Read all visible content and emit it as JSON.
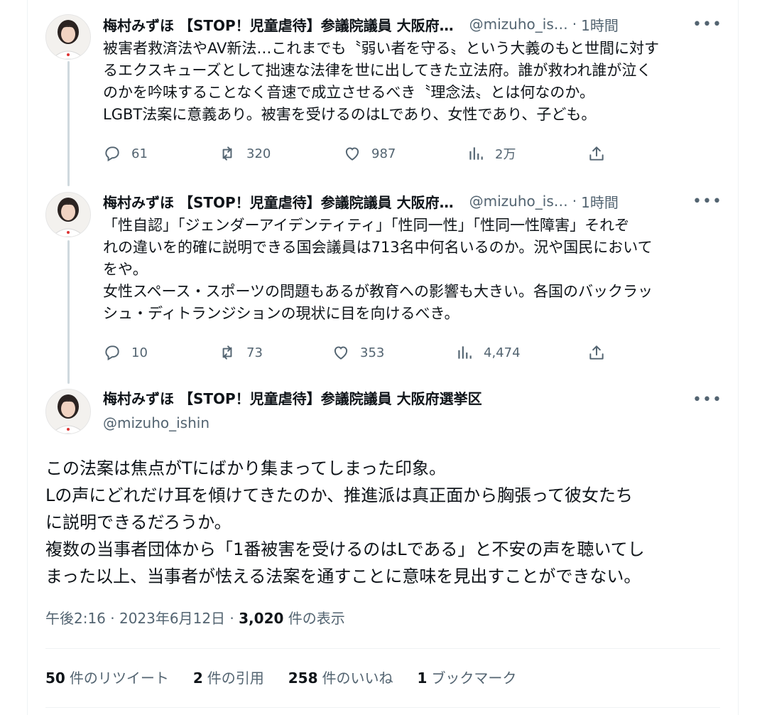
{
  "tweets": [
    {
      "name": "梅村みずほ 【STOP！児童虐待】参議院議員 大阪府…",
      "handle": "@mizuho_is…",
      "time": "1時間",
      "more": "•••",
      "text": "被害者救済法やAV新法…これまでも〝弱い者を守る〟という大義のもと世間に対す\nるエクスキューズとして拙速な法律を世に出してきた立法府。誰が救われ誰が泣く\nのかを吟味することなく音速で成立させるべき〝理念法〟とは何なのか。\nLGBT法案に意義あり。被害を受けるのはLであり、女性であり、子ども。",
      "replies": "61",
      "retweets": "320",
      "likes": "987",
      "views": "2万"
    },
    {
      "name": "梅村みずほ 【STOP！児童虐待】参議院議員 大阪府…",
      "handle": "@mizuho_is…",
      "time": "1時間",
      "more": "•••",
      "text": "「性自認」「ジェンダーアイデンティティ」「性同一性」「性同一性障害」それぞ\nれの違いを的確に説明できる国会議員は713名中何名いるのか。況や国民において\nをや。\n女性スペース・スポーツの問題もあるが教育への影響も大きい。各国のバックラッ\nシュ・ディトランジションの現状に目を向けるべき。",
      "replies": "10",
      "retweets": "73",
      "likes": "353",
      "views": "4,474"
    }
  ],
  "main_tweet": {
    "name": "梅村みずほ 【STOP！児童虐待】参議院議員 大阪府選挙区",
    "handle": "@mizuho_ishin",
    "more": "•••",
    "text": "この法案は焦点がTにばかり集まってしまった印象。\nLの声にどれだけ耳を傾けてきたのか、推進派は真正面から胸張って彼女たち\nに説明できるだろうか。\n複数の当事者団体から「1番被害を受けるのはLである」と不安の声を聴いてし\nまった以上、当事者が怯える法案を通すことに意味を見出すことができない。",
    "timestamp": "午後2:16 · 2023年6月12日 · ",
    "views_count": "3,020",
    "views_label": " 件の表示",
    "stats": [
      {
        "count": "50",
        "label": "件のリツイート"
      },
      {
        "count": "2",
        "label": "件の引用"
      },
      {
        "count": "258",
        "label": "件のいいね"
      },
      {
        "count": "1",
        "label": "ブックマーク"
      }
    ]
  },
  "icons": [
    "reply-icon",
    "retweet-icon",
    "like-icon",
    "views-icon",
    "share-icon",
    "more-icon"
  ],
  "colors": {
    "text": "#0f1419",
    "secondary": "#536471",
    "thread_line": "#cfd9de",
    "divider": "#eff3f4"
  }
}
